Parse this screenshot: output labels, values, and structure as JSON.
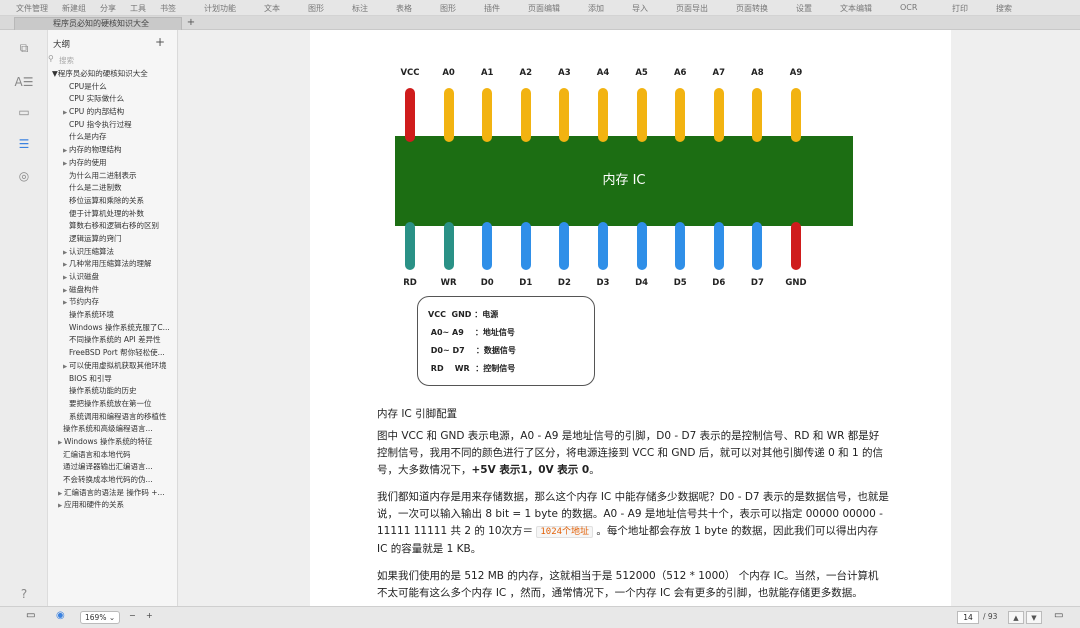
{
  "menubar": {
    "items": [
      "文件管理",
      "新建组",
      "分享",
      "工具",
      "书签",
      "",
      "计划功能",
      "",
      "文本",
      "",
      "图形",
      "",
      "标注",
      "",
      "表格",
      "",
      "图形",
      "",
      "插件",
      "",
      "页面编辑",
      "",
      "添加",
      "",
      "导入",
      "",
      "页面导出",
      "",
      "页面转换",
      "",
      "设置",
      "",
      "文本编辑",
      "",
      "OCR",
      "",
      "打印",
      "",
      "搜索"
    ]
  },
  "tabs": {
    "active": "程序员必知的硬核知识大全",
    "add": "+"
  },
  "outline": {
    "title": "大纲",
    "add": "+",
    "search_placeholder": "搜索",
    "nodes": [
      {
        "label": "▼程序员必知的硬核知识大全",
        "indent": 0,
        "arrow": ""
      },
      {
        "label": "CPU是什么",
        "indent": 3,
        "arrow": ""
      },
      {
        "label": "CPU 实际做什么",
        "indent": 3,
        "arrow": ""
      },
      {
        "label": "CPU 的内部结构",
        "indent": 2,
        "arrow": "▶"
      },
      {
        "label": "CPU 指令执行过程",
        "indent": 3,
        "arrow": ""
      },
      {
        "label": "什么是内存",
        "indent": 3,
        "arrow": ""
      },
      {
        "label": "内存的物理结构",
        "indent": 2,
        "arrow": "▶"
      },
      {
        "label": "内存的使用",
        "indent": 2,
        "arrow": "▶"
      },
      {
        "label": "为什么用二进制表示",
        "indent": 3,
        "arrow": ""
      },
      {
        "label": "什么是二进制数",
        "indent": 3,
        "arrow": ""
      },
      {
        "label": "移位运算和乘除的关系",
        "indent": 3,
        "arrow": ""
      },
      {
        "label": "便于计算机处理的补数",
        "indent": 3,
        "arrow": ""
      },
      {
        "label": "算数右移和逻辑右移的区别",
        "indent": 3,
        "arrow": ""
      },
      {
        "label": "逻辑运算的窍门",
        "indent": 3,
        "arrow": ""
      },
      {
        "label": "认识压缩算法",
        "indent": 2,
        "arrow": "▶"
      },
      {
        "label": "几种常用压缩算法的理解",
        "indent": 2,
        "arrow": "▶"
      },
      {
        "label": "认识磁盘",
        "indent": 2,
        "arrow": "▶"
      },
      {
        "label": "磁盘构件",
        "indent": 2,
        "arrow": "▶"
      },
      {
        "label": "节约内存",
        "indent": 2,
        "arrow": "▶"
      },
      {
        "label": "操作系统环境",
        "indent": 3,
        "arrow": ""
      },
      {
        "label": "Windows 操作系统克服了C...",
        "indent": 3,
        "arrow": ""
      },
      {
        "label": "不同操作系统的 API 差异性",
        "indent": 3,
        "arrow": ""
      },
      {
        "label": "FreeBSD Port 帮你轻松使...",
        "indent": 3,
        "arrow": ""
      },
      {
        "label": "可以使用虚拟机获取其他环境",
        "indent": 2,
        "arrow": "▶"
      },
      {
        "label": "BIOS 和引导",
        "indent": 3,
        "arrow": ""
      },
      {
        "label": "操作系统功能的历史",
        "indent": 3,
        "arrow": ""
      },
      {
        "label": "要把操作系统放在第一位",
        "indent": 3,
        "arrow": ""
      },
      {
        "label": "系统调用和编程语言的移植性",
        "indent": 3,
        "arrow": ""
      },
      {
        "label": "操作系统和高级编程语言...",
        "indent": 2,
        "arrow": ""
      },
      {
        "label": "Windows 操作系统的特征",
        "indent": 1,
        "arrow": "▶"
      },
      {
        "label": "汇编语言和本地代码",
        "indent": 2,
        "arrow": ""
      },
      {
        "label": "通过编译器输出汇编语言...",
        "indent": 2,
        "arrow": ""
      },
      {
        "label": "不会转换成本地代码的伪...",
        "indent": 2,
        "arrow": ""
      },
      {
        "label": "汇编语言的语法是 操作码 +...",
        "indent": 1,
        "arrow": "▶"
      },
      {
        "label": "应用和硬件的关系",
        "indent": 1,
        "arrow": "▶"
      }
    ]
  },
  "diagram": {
    "top_pins": [
      {
        "label": "VCC",
        "color": "#cf1c1c"
      },
      {
        "label": "A0",
        "color": "#f2b311"
      },
      {
        "label": "A1",
        "color": "#f2b311"
      },
      {
        "label": "A2",
        "color": "#f2b311"
      },
      {
        "label": "A3",
        "color": "#f2b311"
      },
      {
        "label": "A4",
        "color": "#f2b311"
      },
      {
        "label": "A5",
        "color": "#f2b311"
      },
      {
        "label": "A6",
        "color": "#f2b311"
      },
      {
        "label": "A7",
        "color": "#f2b311"
      },
      {
        "label": "A8",
        "color": "#f2b311"
      },
      {
        "label": "A9",
        "color": "#f2b311"
      }
    ],
    "bottom_pins": [
      {
        "label": "RD",
        "color": "#2a9186"
      },
      {
        "label": "WR",
        "color": "#2a9186"
      },
      {
        "label": "D0",
        "color": "#2f8fe8"
      },
      {
        "label": "D1",
        "color": "#2f8fe8"
      },
      {
        "label": "D2",
        "color": "#2f8fe8"
      },
      {
        "label": "D3",
        "color": "#2f8fe8"
      },
      {
        "label": "D4",
        "color": "#2f8fe8"
      },
      {
        "label": "D5",
        "color": "#2f8fe8"
      },
      {
        "label": "D6",
        "color": "#2f8fe8"
      },
      {
        "label": "D7",
        "color": "#2f8fe8"
      },
      {
        "label": "GND",
        "color": "#cf1c1c"
      }
    ],
    "chip_label": "内存 IC",
    "chip_color": "#1c6e13",
    "legend": [
      "VCC  GND ：电源",
      " A0~ A9    ：地址信号",
      " D0~ D7    ：数据信号",
      " RD    WR  ：控制信号"
    ]
  },
  "content": {
    "caption": "内存 IC 引脚配置",
    "p1_a": "图中 VCC 和 GND 表示电源，A0 - A9 是地址信号的引脚，D0 - D7 表示的是控制信号、RD 和 WR 都是好控制信号，我用不同的颜色进行了区分，将电源连接到 VCC 和 GND 后，就可以对其他引脚传递 0 和 1 的信号，大多数情况下，",
    "p1_bold": "+5V 表示1，0V 表示 0",
    "p1_b": "。",
    "p2_a": "我们都知道内存是用来存储数据，那么这个内存 IC 中能存储多少数据呢？D0 - D7 表示的是数据信号，也就是说，一次可以输入输出 8 bit = 1 byte 的数据。A0 - A9 是地址信号共十个，表示可以指定 00000 00000 - 11111 11111 共 2 的 10次方＝ ",
    "p2_code": "1024个地址",
    "p2_b": " 。每个地址都会存放 1 byte 的数据，因此我们可以得出内存 IC 的容量就是 1 KB。",
    "p3": "如果我们使用的是 512 MB 的内存，这就相当于是 512000（512 * 1000） 个内存 IC。当然，一台计算机不太可能有这么多个内存 IC ，然而，通常情况下，一个内存 IC 会有更多的引脚，也就能存储更多数据。"
  },
  "statusbar": {
    "zoom": "169%",
    "zoom_minus": "−",
    "zoom_plus": "+",
    "page_current": "14",
    "page_total": "/ 93",
    "nav_up": "▲",
    "nav_down": "▼"
  }
}
